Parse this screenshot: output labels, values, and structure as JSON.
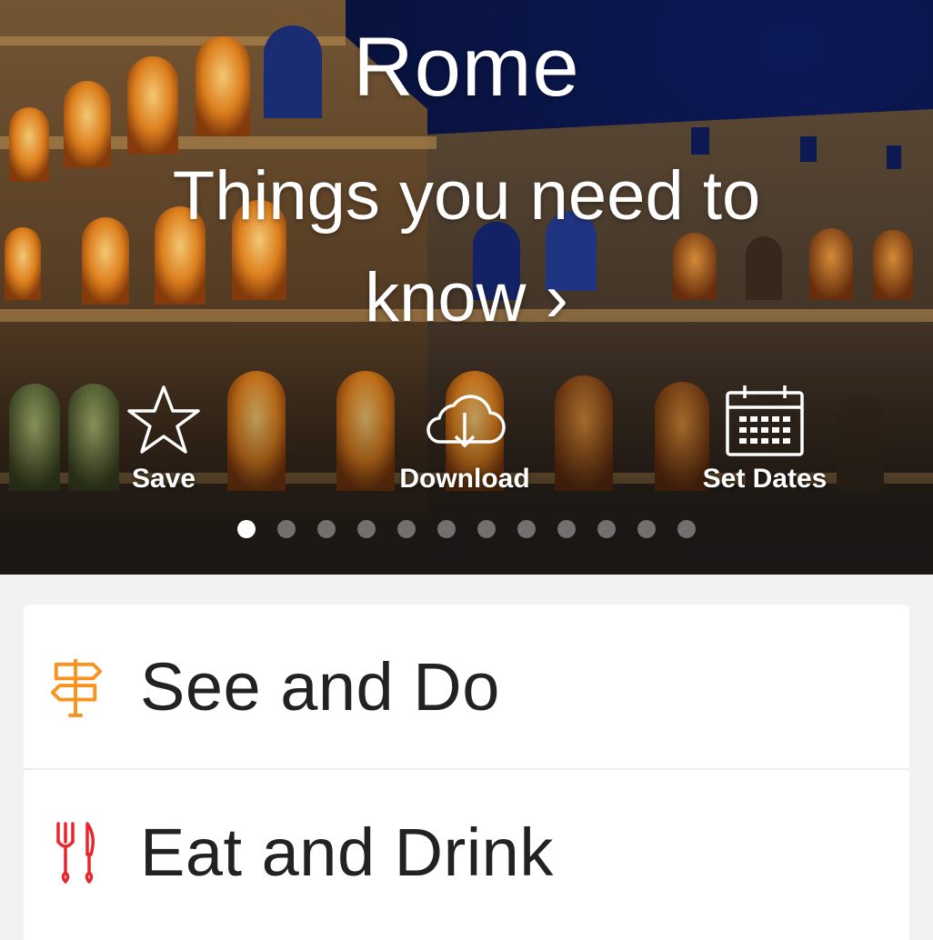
{
  "hero": {
    "title": "Rome",
    "link_text": "Things you need to know",
    "link_chevron": "›"
  },
  "actions": [
    {
      "label": "Save",
      "icon": "star-icon"
    },
    {
      "label": "Download",
      "icon": "cloud-download-icon"
    },
    {
      "label": "Set Dates",
      "icon": "calendar-icon"
    }
  ],
  "carousel": {
    "page_count": 12,
    "active_index": 0
  },
  "sections": [
    {
      "label": "See and Do",
      "icon": "signpost-icon",
      "icon_color": "#f7931e"
    },
    {
      "label": "Eat and Drink",
      "icon": "fork-knife-icon",
      "icon_color": "#e8262d"
    }
  ],
  "colors": {
    "sky": "#0a1652",
    "hero_text": "#ffffff",
    "list_background": "#f2f2f2",
    "row_text": "#222222"
  }
}
